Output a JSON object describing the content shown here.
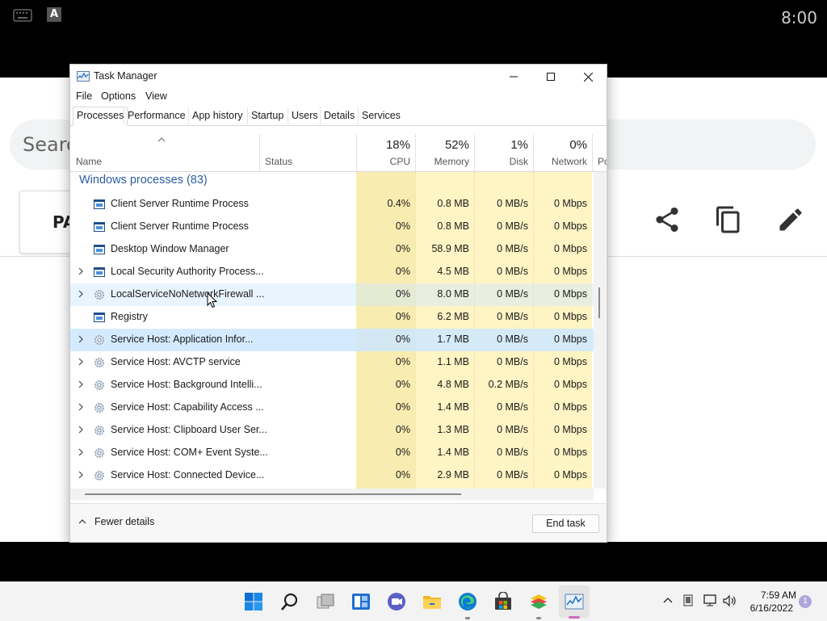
{
  "background_app": {
    "status_time": "8:00",
    "search_text": "Searc",
    "card_text": "PA",
    "actions": [
      "share-icon",
      "copy-icon",
      "edit-icon"
    ]
  },
  "window": {
    "title": "Task Manager",
    "controls": [
      "minimize",
      "maximize",
      "close"
    ]
  },
  "menu": [
    "File",
    "Options",
    "View"
  ],
  "tabs": [
    "Processes",
    "Performance",
    "App history",
    "Startup",
    "Users",
    "Details",
    "Services"
  ],
  "active_tab": "Processes",
  "columns": {
    "name": "Name",
    "status": "Status",
    "cpu": {
      "pct": "18%",
      "label": "CPU"
    },
    "memory": {
      "pct": "52%",
      "label": "Memory"
    },
    "disk": {
      "pct": "1%",
      "label": "Disk"
    },
    "network": {
      "pct": "0%",
      "label": "Network"
    },
    "power": "Po"
  },
  "group": {
    "label": "Windows processes (83)"
  },
  "processes": [
    {
      "name": "Client Server Runtime Process",
      "cpu": "0.4%",
      "memory": "0.8 MB",
      "disk": "0 MB/s",
      "network": "0 Mbps",
      "icon": "window-icon",
      "expandable": false
    },
    {
      "name": "Client Server Runtime Process",
      "cpu": "0%",
      "memory": "0.8 MB",
      "disk": "0 MB/s",
      "network": "0 Mbps",
      "icon": "window-icon",
      "expandable": false
    },
    {
      "name": "Desktop Window Manager",
      "cpu": "0%",
      "memory": "58.9 MB",
      "disk": "0 MB/s",
      "network": "0 Mbps",
      "icon": "window-icon",
      "expandable": false
    },
    {
      "name": "Local Security Authority Process...",
      "cpu": "0%",
      "memory": "4.5 MB",
      "disk": "0 MB/s",
      "network": "0 Mbps",
      "icon": "window-icon",
      "expandable": true
    },
    {
      "name": "LocalServiceNoNetworkFirewall ...",
      "cpu": "0%",
      "memory": "8.0 MB",
      "disk": "0 MB/s",
      "network": "0 Mbps",
      "icon": "gear-icon",
      "expandable": true
    },
    {
      "name": "Registry",
      "cpu": "0%",
      "memory": "6.2 MB",
      "disk": "0 MB/s",
      "network": "0 Mbps",
      "icon": "window-icon",
      "expandable": false
    },
    {
      "name": "Service Host: Application Infor...",
      "cpu": "0%",
      "memory": "1.7 MB",
      "disk": "0 MB/s",
      "network": "0 Mbps",
      "icon": "gear-icon",
      "expandable": true
    },
    {
      "name": "Service Host: AVCTP service",
      "cpu": "0%",
      "memory": "1.1 MB",
      "disk": "0 MB/s",
      "network": "0 Mbps",
      "icon": "gear-icon",
      "expandable": true
    },
    {
      "name": "Service Host: Background Intelli...",
      "cpu": "0%",
      "memory": "4.8 MB",
      "disk": "0.2 MB/s",
      "network": "0 Mbps",
      "icon": "gear-icon",
      "expandable": true
    },
    {
      "name": "Service Host: Capability Access ...",
      "cpu": "0%",
      "memory": "1.4 MB",
      "disk": "0 MB/s",
      "network": "0 Mbps",
      "icon": "gear-icon",
      "expandable": true
    },
    {
      "name": "Service Host: Clipboard User Ser...",
      "cpu": "0%",
      "memory": "1.3 MB",
      "disk": "0 MB/s",
      "network": "0 Mbps",
      "icon": "gear-icon",
      "expandable": true
    },
    {
      "name": "Service Host: COM+ Event Syste...",
      "cpu": "0%",
      "memory": "1.4 MB",
      "disk": "0 MB/s",
      "network": "0 Mbps",
      "icon": "gear-icon",
      "expandable": true
    },
    {
      "name": "Service Host: Connected Device...",
      "cpu": "0%",
      "memory": "2.9 MB",
      "disk": "0 MB/s",
      "network": "0 Mbps",
      "icon": "gear-icon",
      "expandable": true
    }
  ],
  "hover_row": 4,
  "selected_row": 6,
  "footer": {
    "fewer_details": "Fewer details",
    "end_task": "End task"
  },
  "colors": {
    "heat_light": "#fff4c4",
    "heat_medium": "#f9ecb0",
    "group_text": "#2c5fa3",
    "selection": "#cce8ff"
  },
  "taskbar": {
    "icons": [
      "windows-start-icon",
      "search-icon",
      "task-view-icon",
      "widgets-icon",
      "teams-chat-icon",
      "file-explorer-icon",
      "edge-icon",
      "store-icon",
      "bluestacks-icon",
      "task-manager-icon"
    ],
    "time": "7:59 AM",
    "date": "6/16/2022",
    "notification_count": "1"
  }
}
